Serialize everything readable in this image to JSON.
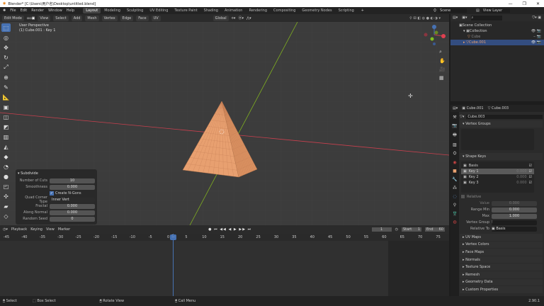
{
  "window": {
    "title": "Blender* [C:\\Users\\用户名\\Desktop\\untitled.blend]",
    "controls": [
      "—",
      "❐",
      "✕"
    ]
  },
  "menu": {
    "items": [
      "File",
      "Edit",
      "Render",
      "Window",
      "Help"
    ],
    "workspaces": [
      "Layout",
      "Modeling",
      "Sculpting",
      "UV Editing",
      "Texture Paint",
      "Shading",
      "Animation",
      "Rendering",
      "Compositing",
      "Geometry Nodes",
      "Scripting"
    ],
    "active_workspace": "Layout",
    "scene": "Scene",
    "view_layer": "View Layer"
  },
  "viewport_header": {
    "mode": "Edit Mode",
    "menus": [
      "View",
      "Select",
      "Add",
      "Mesh",
      "Vertex",
      "Edge",
      "Face",
      "UV"
    ],
    "transform_orientation": "Global"
  },
  "viewport": {
    "view_name": "User Perspective",
    "object_info": "(1) Cube.001 : Key 1",
    "mesh_color": "#e8a070"
  },
  "operator_panel": {
    "title": "Subdivide",
    "fields": [
      {
        "label": "Number of Cuts",
        "value": "10"
      },
      {
        "label": "Smoothness",
        "value": "0.000"
      }
    ],
    "checkbox": {
      "label": "Create N-Gons",
      "checked": true
    },
    "fields2": [
      {
        "label": "Quad Corner Type",
        "value": "Inner Vert"
      },
      {
        "label": "Fractal",
        "value": "0.000"
      },
      {
        "label": "Along Normal",
        "value": "0.000"
      },
      {
        "label": "Random Seed",
        "value": "0"
      }
    ]
  },
  "timeline": {
    "menus": [
      "Playback",
      "Keying",
      "View",
      "Marker"
    ],
    "current_frame": "1",
    "start_label": "Start",
    "start": "1",
    "end_label": "End",
    "end": "60",
    "ticks": [
      "-45",
      "-40",
      "-35",
      "-30",
      "-25",
      "-20",
      "-15",
      "-10",
      "-5",
      "0",
      "5",
      "10",
      "15",
      "20",
      "25",
      "30",
      "35",
      "40",
      "45",
      "50",
      "55",
      "60",
      "65",
      "70",
      "75"
    ]
  },
  "status": {
    "items": [
      "Select",
      "Box Select",
      "Rotate View",
      "Call Menu"
    ],
    "version": "2.90.1"
  },
  "outliner": {
    "items": [
      {
        "label": "Scene Collection"
      },
      {
        "label": "Collection"
      },
      {
        "label": "Cube"
      },
      {
        "label": "Cube.001",
        "selected": true
      }
    ]
  },
  "properties": {
    "object": "Cube.001",
    "mesh": "Cube.003",
    "data_name": "Cube.003",
    "vertex_groups_title": "Vertex Groups",
    "shape_keys_title": "Shape Keys",
    "shape_keys": [
      {
        "name": "Basis",
        "value": ""
      },
      {
        "name": "Key 1",
        "value": "0.000",
        "selected": true
      },
      {
        "name": "Key 2",
        "value": "0.000"
      },
      {
        "name": "Key 3",
        "value": "0.000"
      }
    ],
    "relative_label": "Relative",
    "value_label": "Value",
    "value": "0.000",
    "range_min_label": "Range Min",
    "range_min": "0.000",
    "max_label": "Max",
    "max": "1.000",
    "vertex_group_label": "Vertex Group",
    "relative_to_label": "Relative To",
    "relative_to": "Basis",
    "panels": [
      "UV Maps",
      "Vertex Colors",
      "Face Maps",
      "Normals",
      "Texture Space",
      "Remesh",
      "Geometry Data",
      "Custom Properties"
    ]
  },
  "colors": {
    "accent": "#4772b3",
    "x_axis": "#c8404e",
    "y_axis": "#80b020",
    "playhead": "#4772b3"
  }
}
